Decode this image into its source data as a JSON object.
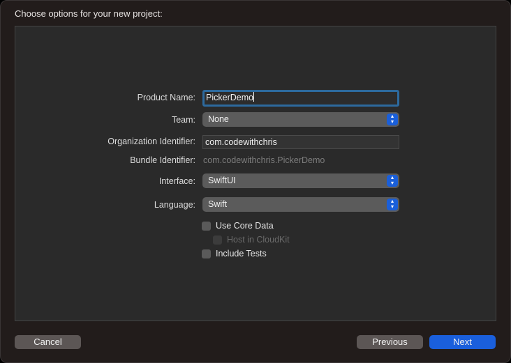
{
  "dialog": {
    "title": "Choose options for your new project:"
  },
  "form": {
    "product_name": {
      "label": "Product Name:",
      "value": "PickerDemo"
    },
    "team": {
      "label": "Team:",
      "value": "None"
    },
    "org_id": {
      "label": "Organization Identifier:",
      "value": "com.codewithchris"
    },
    "bundle_id": {
      "label": "Bundle Identifier:",
      "value": "com.codewithchris.PickerDemo"
    },
    "interface": {
      "label": "Interface:",
      "value": "SwiftUI"
    },
    "language": {
      "label": "Language:",
      "value": "Swift"
    },
    "stepper_glyph": "⌃⌄"
  },
  "checkboxes": {
    "core_data": {
      "label": "Use Core Data",
      "checked": false
    },
    "cloudkit": {
      "label": "Host in CloudKit",
      "checked": false,
      "enabled": false
    },
    "tests": {
      "label": "Include Tests",
      "checked": false
    }
  },
  "buttons": {
    "cancel": "Cancel",
    "previous": "Previous",
    "next": "Next"
  },
  "colors": {
    "accent": "#1a5fdc",
    "focus_ring": "#2d6a9e"
  }
}
